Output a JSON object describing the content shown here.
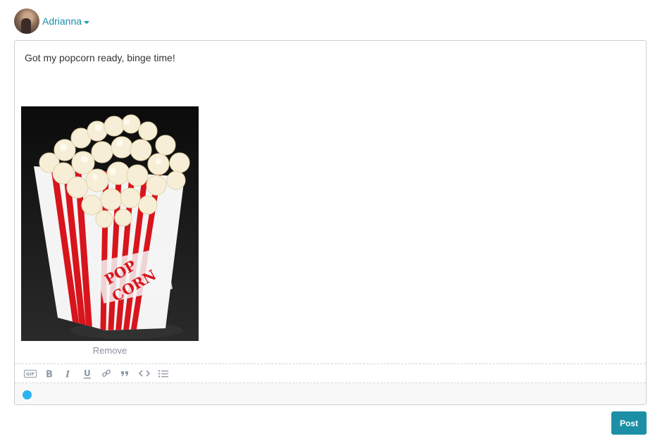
{
  "user": {
    "name": "Adrianna"
  },
  "composer": {
    "message": "Got my popcorn ready, binge time!",
    "attachment": {
      "alt": "Popcorn in a red and white striped box",
      "remove_label": "Remove"
    }
  },
  "toolbar": {
    "icons": [
      "gif-icon",
      "bold-icon",
      "italic-icon",
      "underline-icon",
      "link-icon",
      "quote-icon",
      "code-icon",
      "list-icon"
    ]
  },
  "status": {
    "color": "#2cb3ef"
  },
  "actions": {
    "post_label": "Post"
  },
  "colors": {
    "accent": "#1c8fa6",
    "link": "#1a8fa8"
  }
}
